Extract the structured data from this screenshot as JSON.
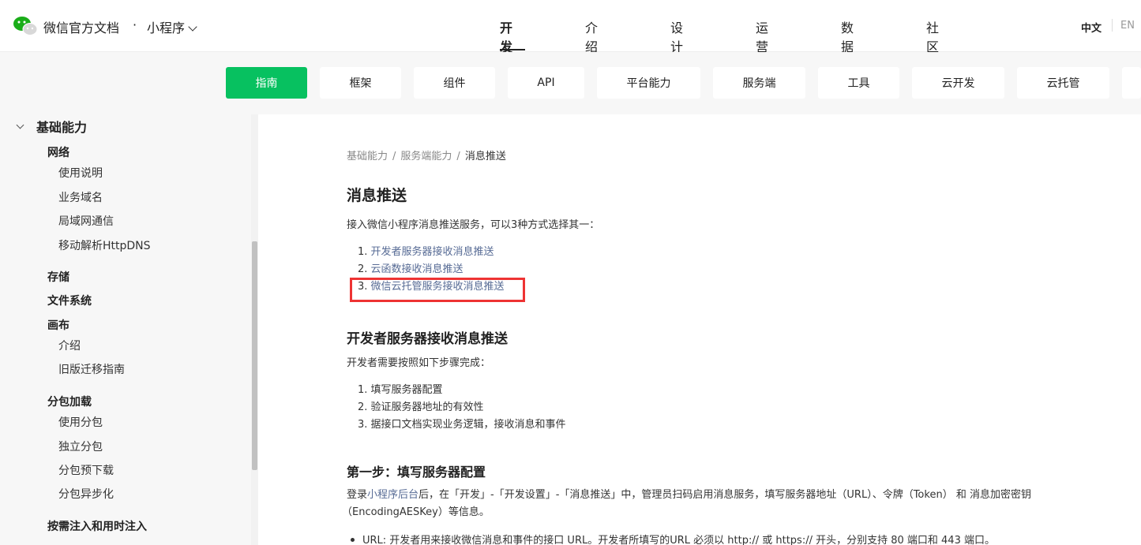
{
  "header": {
    "site_title": "微信官方文档",
    "separator": "·",
    "product": "小程序",
    "nav": [
      "开发",
      "介绍",
      "设计",
      "运营",
      "数据",
      "社区"
    ],
    "active_nav": "开发",
    "lang_zh": "中文",
    "lang_en": "EN"
  },
  "subnav": {
    "items": [
      "指南",
      "框架",
      "组件",
      "API",
      "平台能力",
      "服务端",
      "工具",
      "云开发",
      "云托管"
    ],
    "active": "指南",
    "accent": "#07c160"
  },
  "sidebar": {
    "section": "基础能力",
    "groups": {
      "network": "网络",
      "network_items": [
        "使用说明",
        "业务域名",
        "局域网通信",
        "移动解析HttpDNS"
      ],
      "storage": "存储",
      "filesystem": "文件系统",
      "canvas": "画布",
      "canvas_items": [
        "介绍",
        "旧版迁移指南"
      ],
      "subpackage": "分包加载",
      "subpackage_items": [
        "使用分包",
        "独立分包",
        "分包预下载",
        "分包异步化"
      ],
      "inject": "按需注入和用时注入"
    }
  },
  "content": {
    "breadcrumb": [
      "基础能力",
      "服务端能力",
      "消息推送"
    ],
    "breadcrumb_sep": "/",
    "title": "消息推送",
    "intro": "接入微信小程序消息推送服务，可以3种方式选择其一：",
    "options": [
      {
        "num": "1.",
        "label": "开发者服务器接收消息推送"
      },
      {
        "num": "2.",
        "label": "云函数接收消息推送"
      },
      {
        "num": "3.",
        "label": "微信云托管服务接收消息推送"
      }
    ],
    "sec1_title": "开发者服务器接收消息推送",
    "sec1_intro": "开发者需要按照如下步骤完成：",
    "steps": [
      {
        "num": "1.",
        "label": "填写服务器配置"
      },
      {
        "num": "2.",
        "label": "验证服务器地址的有效性"
      },
      {
        "num": "3.",
        "label": "据接口文档实现业务逻辑，接收消息和事件"
      }
    ],
    "step1_title": "第一步：填写服务器配置",
    "step1_p_a": "登录",
    "step1_p_link": "小程序后台",
    "step1_p_b": "后，在「开发」-「开发设置」-「消息推送」中，管理员扫码启用消息服务，填写服务器地址（URL）、令牌（Token） 和 消息加密密钥",
    "step1_p_c": "（EncodingAESKey）等信息。",
    "bullet_url": "URL: 开发者用来接收微信消息和事件的接口 URL。开发者所填写的URL 必须以 http:// 或 https:// 开头，分别支持 80 端口和 443 端口。"
  },
  "colors": {
    "link": "#576b95",
    "highlight_box": "#ee3333",
    "sidebar_bg": "#f7f7f7"
  }
}
